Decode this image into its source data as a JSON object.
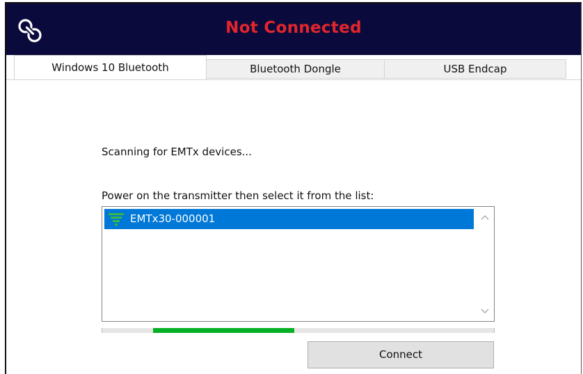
{
  "header": {
    "status_text": "Not Connected",
    "status_color": "#e3262b",
    "background_color": "#0b0a3c",
    "logo_icon": "chain-link-icon"
  },
  "tabs": [
    {
      "label": "Windows 10 Bluetooth",
      "active": true
    },
    {
      "label": "Bluetooth Dongle",
      "active": false
    },
    {
      "label": "USB Endcap",
      "active": false
    }
  ],
  "panel": {
    "scan_text": "Scanning for EMTx devices...",
    "instruction_text": "Power on the transmitter then select it from the list:",
    "devices": [
      {
        "name": "EMTx30-000001",
        "selected": true,
        "icon": "signal-strength-icon"
      }
    ],
    "progress": {
      "start_fraction": 0.13,
      "end_fraction": 0.49,
      "color": "#06b025"
    },
    "connect_label": "Connect"
  }
}
